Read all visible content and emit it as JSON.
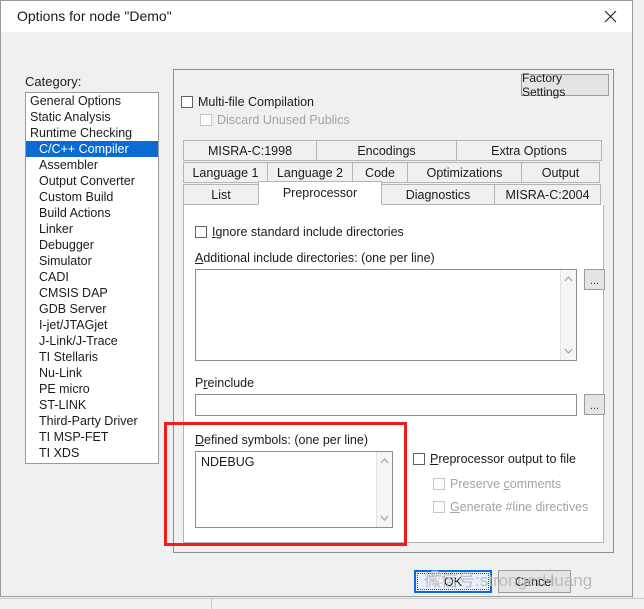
{
  "window": {
    "title": "Options for node \"Demo\"",
    "close_icon": "close-icon"
  },
  "category": {
    "label": "Category:",
    "selected": "C/C++ Compiler",
    "items": [
      {
        "label": "General Options",
        "indent": false
      },
      {
        "label": "Static Analysis",
        "indent": false
      },
      {
        "label": "Runtime Checking",
        "indent": false
      },
      {
        "label": "C/C++ Compiler",
        "indent": true
      },
      {
        "label": "Assembler",
        "indent": true
      },
      {
        "label": "Output Converter",
        "indent": true
      },
      {
        "label": "Custom Build",
        "indent": true
      },
      {
        "label": "Build Actions",
        "indent": true
      },
      {
        "label": "Linker",
        "indent": true
      },
      {
        "label": "Debugger",
        "indent": true
      },
      {
        "label": "Simulator",
        "indent": true
      },
      {
        "label": "CADI",
        "indent": true
      },
      {
        "label": "CMSIS DAP",
        "indent": true
      },
      {
        "label": "GDB Server",
        "indent": true
      },
      {
        "label": "I-jet/JTAGjet",
        "indent": true
      },
      {
        "label": "J-Link/J-Trace",
        "indent": true
      },
      {
        "label": "TI Stellaris",
        "indent": true
      },
      {
        "label": "Nu-Link",
        "indent": true
      },
      {
        "label": "PE micro",
        "indent": true
      },
      {
        "label": "ST-LINK",
        "indent": true
      },
      {
        "label": "Third-Party Driver",
        "indent": true
      },
      {
        "label": "TI MSP-FET",
        "indent": true
      },
      {
        "label": "TI XDS",
        "indent": true
      }
    ]
  },
  "options_pane": {
    "factory_settings_label": "Factory Settings",
    "multi_file_compilation": {
      "label": "Multi-file Compilation",
      "checked": false,
      "enabled": true
    },
    "discard_unused_publics": {
      "label": "Discard Unused Publics",
      "checked": false,
      "enabled": false
    }
  },
  "tabs": {
    "row1": [
      {
        "label": "MISRA-C:1998",
        "active": false
      },
      {
        "label": "Encodings",
        "active": false
      },
      {
        "label": "Extra Options",
        "active": false
      }
    ],
    "row2": [
      {
        "label": "Language 1",
        "active": false
      },
      {
        "label": "Language 2",
        "active": false
      },
      {
        "label": "Code",
        "active": false
      },
      {
        "label": "Optimizations",
        "active": false
      },
      {
        "label": "Output",
        "active": false
      }
    ],
    "row3": [
      {
        "label": "List",
        "active": false
      },
      {
        "label": "Preprocessor",
        "active": true
      },
      {
        "label": "Diagnostics",
        "active": false
      },
      {
        "label": "MISRA-C:2004",
        "active": false
      }
    ],
    "active_tab": "Preprocessor"
  },
  "preprocessor": {
    "ignore_standard_includes": {
      "mnemonic": "I",
      "label_rest": "gnore standard include directories",
      "checked": false
    },
    "additional_includes": {
      "mnemonic": "A",
      "label_rest": "dditional include directories: (one per line)",
      "value": "",
      "browse_label": "...",
      "scroll_up_icon": "chevron-up-icon",
      "scroll_down_icon": "chevron-down-icon"
    },
    "preinclude": {
      "label_pre": "P",
      "mnemonic": "r",
      "label_rest": "einclude",
      "value": "",
      "browse_label": "..."
    },
    "defined_symbols": {
      "mnemonic": "D",
      "label_rest": "efined symbols: (one per line)",
      "value": "NDEBUG",
      "scroll_up_icon": "chevron-up-icon",
      "scroll_down_icon": "chevron-down-icon"
    },
    "preprocessor_output_to_file": {
      "label_pre": "",
      "mnemonic": "P",
      "label_rest": "reprocessor output to file",
      "checked": false,
      "enabled": true
    },
    "preserve_comments": {
      "label_pre": "Preserve ",
      "mnemonic": "c",
      "label_rest": "omments",
      "checked": false,
      "enabled": false
    },
    "generate_line_directives": {
      "label_pre": "",
      "mnemonic": "G",
      "label_rest": "enerate #line directives",
      "checked": false,
      "enabled": false
    }
  },
  "footer": {
    "ok_label": "OK",
    "cancel_label": "Cancel"
  },
  "watermark": {
    "text": "微信号:strongerHuang"
  },
  "colors": {
    "selection_blue": "#0a6cd0",
    "annotation_red": "#ee1c1c",
    "dialog_bg": "#f0f0f0",
    "field_bg": "#ffffff",
    "disabled_text": "#a3a3a3"
  }
}
